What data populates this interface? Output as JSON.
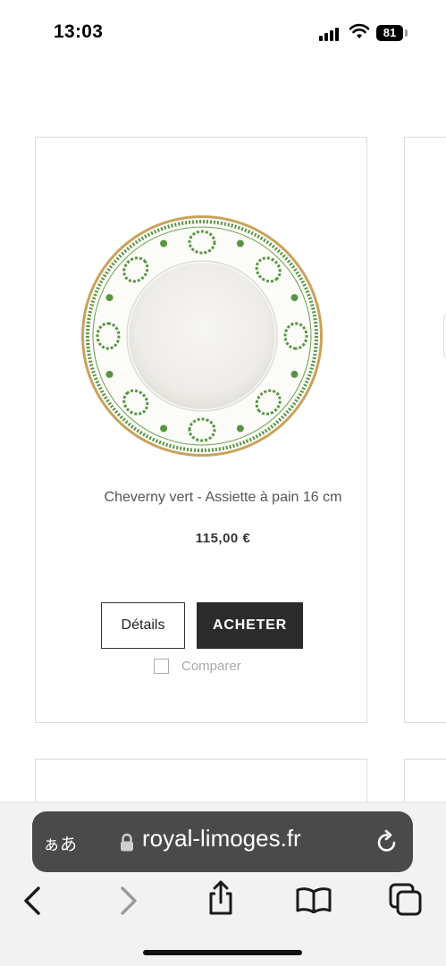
{
  "status_bar": {
    "time": "13:03",
    "battery": "81"
  },
  "product": {
    "name": "Cheverny vert - Assiette à pain 16 cm",
    "price": "115,00 €",
    "details_label": "Détails",
    "buy_label": "ACHETER",
    "compare_label": "Comparer",
    "compare_checked": false
  },
  "browser": {
    "text_size_label": "ぁあ",
    "url": "royal-limoges.fr"
  },
  "colors": {
    "plate_green": "#5a9443",
    "gold_rim": "#c9a25a",
    "buy_button_bg": "#2b2b2b",
    "url_bar_bg": "#4a4a4a"
  },
  "icons": [
    "signal-icon",
    "wifi-icon",
    "battery-icon",
    "lock-icon",
    "reload-icon",
    "back-icon",
    "forward-icon",
    "share-icon",
    "bookmarks-icon",
    "tabs-icon"
  ]
}
